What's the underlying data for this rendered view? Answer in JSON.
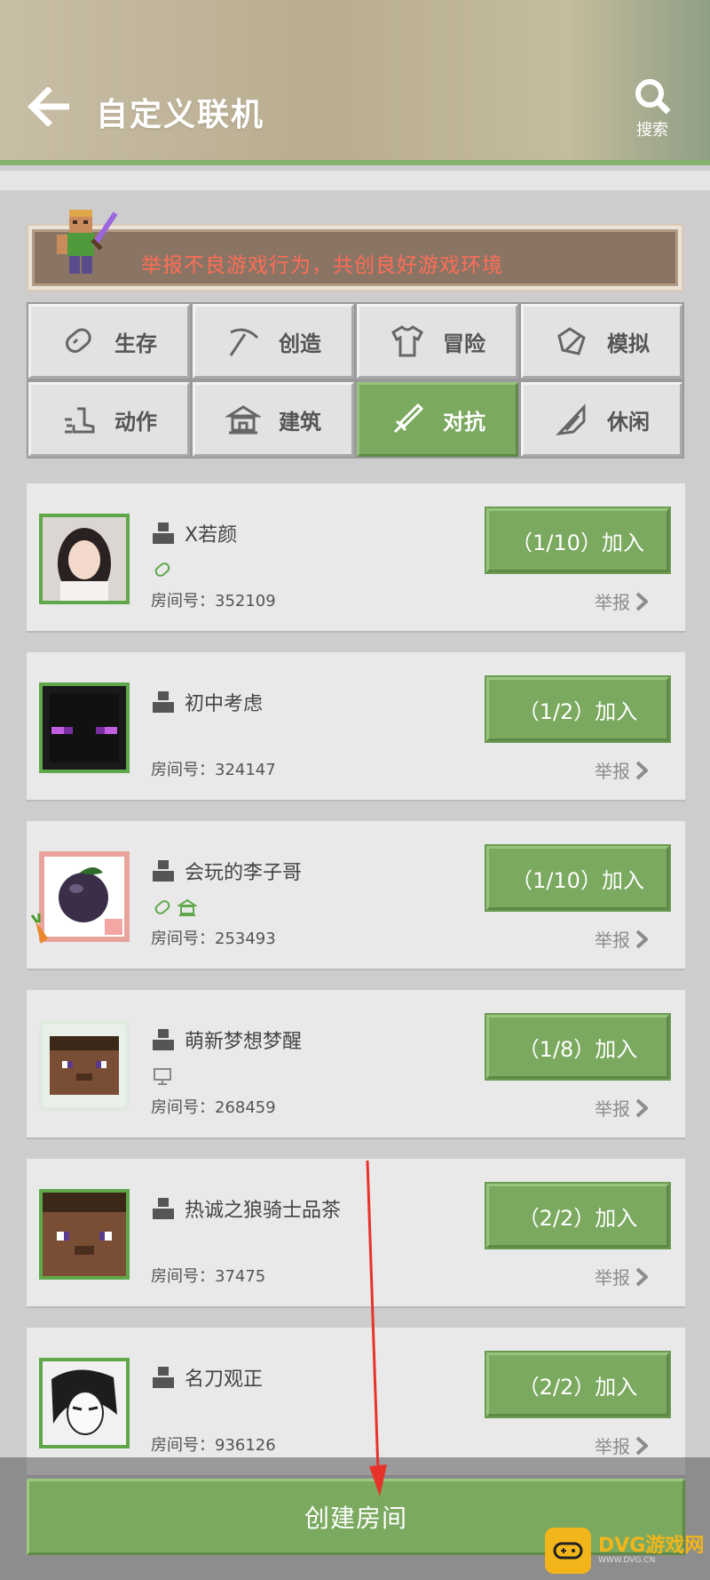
{
  "header": {
    "title": "自定义联机",
    "search_label": "搜索"
  },
  "banner": {
    "text": "举报不良游戏行为，共创良好游戏环境"
  },
  "categories": [
    {
      "label": "生存",
      "icon": "bread-icon",
      "active": false
    },
    {
      "label": "创造",
      "icon": "pickaxe-icon",
      "active": false
    },
    {
      "label": "冒险",
      "icon": "shirt-icon",
      "active": false
    },
    {
      "label": "模拟",
      "icon": "map-icon",
      "active": false
    },
    {
      "label": "动作",
      "icon": "boot-icon",
      "active": false
    },
    {
      "label": "建筑",
      "icon": "temple-icon",
      "active": false
    },
    {
      "label": "对抗",
      "icon": "sword-icon",
      "active": true
    },
    {
      "label": "休闲",
      "icon": "fishing-rod-icon",
      "active": false
    }
  ],
  "rooms": [
    {
      "name": "X若颜",
      "room_id": "房间号：352109",
      "join_label": "（1/10）加入",
      "report_label": "举报",
      "tags": [
        "bread-icon"
      ]
    },
    {
      "name": "初中考虑",
      "room_id": "房间号：324147",
      "join_label": "（1/2）加入",
      "report_label": "举报",
      "tags": []
    },
    {
      "name": "会玩的李子哥",
      "room_id": "房间号：253493",
      "join_label": "（1/10）加入",
      "report_label": "举报",
      "tags": [
        "bread-icon",
        "temple-icon"
      ]
    },
    {
      "name": "萌新梦想梦醒",
      "room_id": "房间号：268459",
      "join_label": "（1/8）加入",
      "report_label": "举报",
      "tags": [
        "monitor-icon"
      ]
    },
    {
      "name": "热诚之狼骑士品茶",
      "room_id": "房间号：37475",
      "join_label": "（2/2）加入",
      "report_label": "举报",
      "tags": []
    },
    {
      "name": "名刀观正",
      "room_id": "房间号：936126",
      "join_label": "（2/2）加入",
      "report_label": "举报",
      "tags": []
    }
  ],
  "create_button": {
    "label": "创建房间"
  },
  "watermark": {
    "name": "DVG游戏网",
    "url": "WWW.DVG.CN"
  },
  "colors": {
    "accent_green": "#7aa95f",
    "banner_text": "#ff6d57",
    "annotation_arrow": "#e8332a"
  }
}
